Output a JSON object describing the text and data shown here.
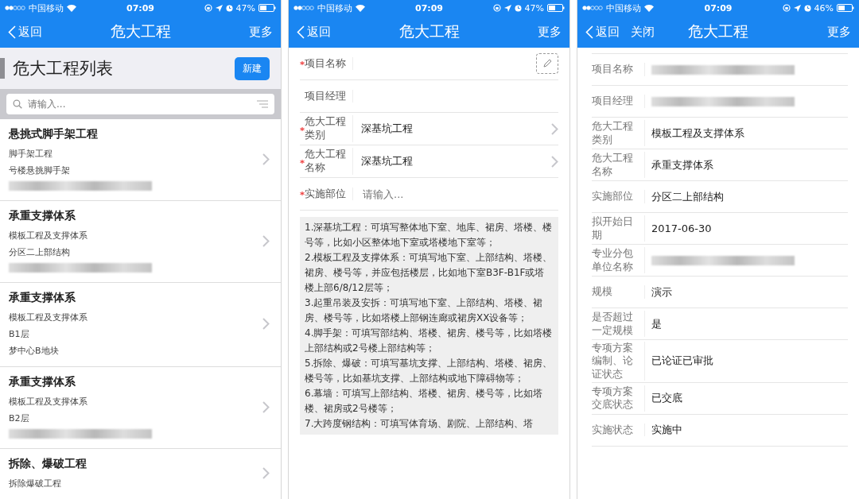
{
  "screens": [
    {
      "kind": "list",
      "status_bar": {
        "carrier": "中国移动",
        "time": "07:09",
        "battery": "47%"
      },
      "nav": {
        "back": "返回",
        "title": "危大工程",
        "more": "更多"
      },
      "header": {
        "title": "危大工程列表",
        "button": "新建"
      },
      "search": {
        "placeholder": "请输入..."
      },
      "items": [
        {
          "title": "悬挑式脚手架工程",
          "lines": [
            {
              "kind": "text",
              "text": "脚手架工程"
            },
            {
              "kind": "text",
              "text": "号楼悬挑脚手架"
            },
            {
              "kind": "blurred"
            }
          ]
        },
        {
          "title": "承重支撑体系",
          "lines": [
            {
              "kind": "text",
              "text": "模板工程及支撑体系"
            },
            {
              "kind": "text",
              "text": "分区二上部结构"
            },
            {
              "kind": "blurred"
            }
          ]
        },
        {
          "title": "承重支撑体系",
          "lines": [
            {
              "kind": "text",
              "text": "模板工程及支撑体系"
            },
            {
              "kind": "text",
              "text": "B1层"
            },
            {
              "kind": "text",
              "text": "梦中心B地块"
            }
          ]
        },
        {
          "title": "承重支撑体系",
          "lines": [
            {
              "kind": "text",
              "text": "模板工程及支撑体系"
            },
            {
              "kind": "text",
              "text": "B2层"
            },
            {
              "kind": "blurred"
            }
          ]
        },
        {
          "title": "拆除、爆破工程",
          "lines": [
            {
              "kind": "text",
              "text": "拆除爆破工程"
            }
          ]
        }
      ]
    },
    {
      "kind": "form",
      "status_bar": {
        "carrier": "中国移动",
        "time": "07:09",
        "battery": "47%"
      },
      "nav": {
        "back": "返回",
        "title": "危大工程",
        "more": "更多"
      },
      "fields": [
        {
          "kind": "pencil",
          "label": "项目名称",
          "required": true
        },
        {
          "kind": "text",
          "label": "项目经理",
          "required": false
        },
        {
          "kind": "select",
          "label": "危大工程类别",
          "required": true,
          "value": "深基坑工程"
        },
        {
          "kind": "select",
          "label": "危大工程名称",
          "required": true,
          "value": "深基坑工程"
        },
        {
          "kind": "text",
          "label": "实施部位",
          "required": true,
          "placeholder": "请输入..."
        }
      ],
      "note": [
        "1.深基坑工程：可填写整体地下室、地库、裙房、塔楼、楼号等，比如小区整体地下室或塔楼地下室等；",
        "2.模板工程及支撑体系：可填写地下室、上部结构、塔楼、裙房、楼号等，并应包括楼层，比如地下室B3F-B1F或塔楼上部6/8/12层等；",
        "3.起重吊装及安拆：可填写地下室、上部结构、塔楼、裙房、楼号等，比如塔楼上部钢连廊或裙房XX设备等；",
        "4.脚手架：可填写部结构、塔楼、裙房、楼号等，比如塔楼上部结构或2号楼上部结构等；",
        "5.拆除、爆破：可填写基坑支撑、上部结构、塔楼、裙房、楼号等，比如基坑支撑、上部结构或地下障碍物等；",
        "6.幕墙：可填写上部结构、塔楼、裙房、楼号等，比如塔楼、裙房或2号楼等；",
        "7.大跨度钢结构：可填写体育场、剧院、上部结构、塔"
      ]
    },
    {
      "kind": "detail",
      "status_bar": {
        "carrier": "中国移动",
        "time": "07:09",
        "battery": "46%"
      },
      "nav": {
        "back": "返回",
        "close": "关闭",
        "title": "危大工程",
        "more": "更多"
      },
      "rows": [
        {
          "kind": "blurred",
          "label": "项目名称"
        },
        {
          "kind": "blurred",
          "label": "项目经理"
        },
        {
          "kind": "text",
          "label": "危大工程类别",
          "value": "模板工程及支撑体系"
        },
        {
          "kind": "text",
          "label": "危大工程名称",
          "value": "承重支撑体系"
        },
        {
          "kind": "text",
          "label": "实施部位",
          "value": "分区二上部结构"
        },
        {
          "kind": "text",
          "label": "拟开始日期",
          "value": "2017-06-30"
        },
        {
          "kind": "blurred",
          "label": "专业分包单位名称"
        },
        {
          "kind": "text",
          "label": "规模",
          "value": "演示"
        },
        {
          "kind": "text",
          "label": "是否超过一定规模",
          "value": "是"
        },
        {
          "kind": "text",
          "label": "专项方案编制、论证状态",
          "value": "已论证已审批"
        },
        {
          "kind": "text",
          "label": "专项方案交底状态",
          "value": "已交底"
        },
        {
          "kind": "text",
          "label": "实施状态",
          "value": "实施中"
        }
      ]
    }
  ]
}
